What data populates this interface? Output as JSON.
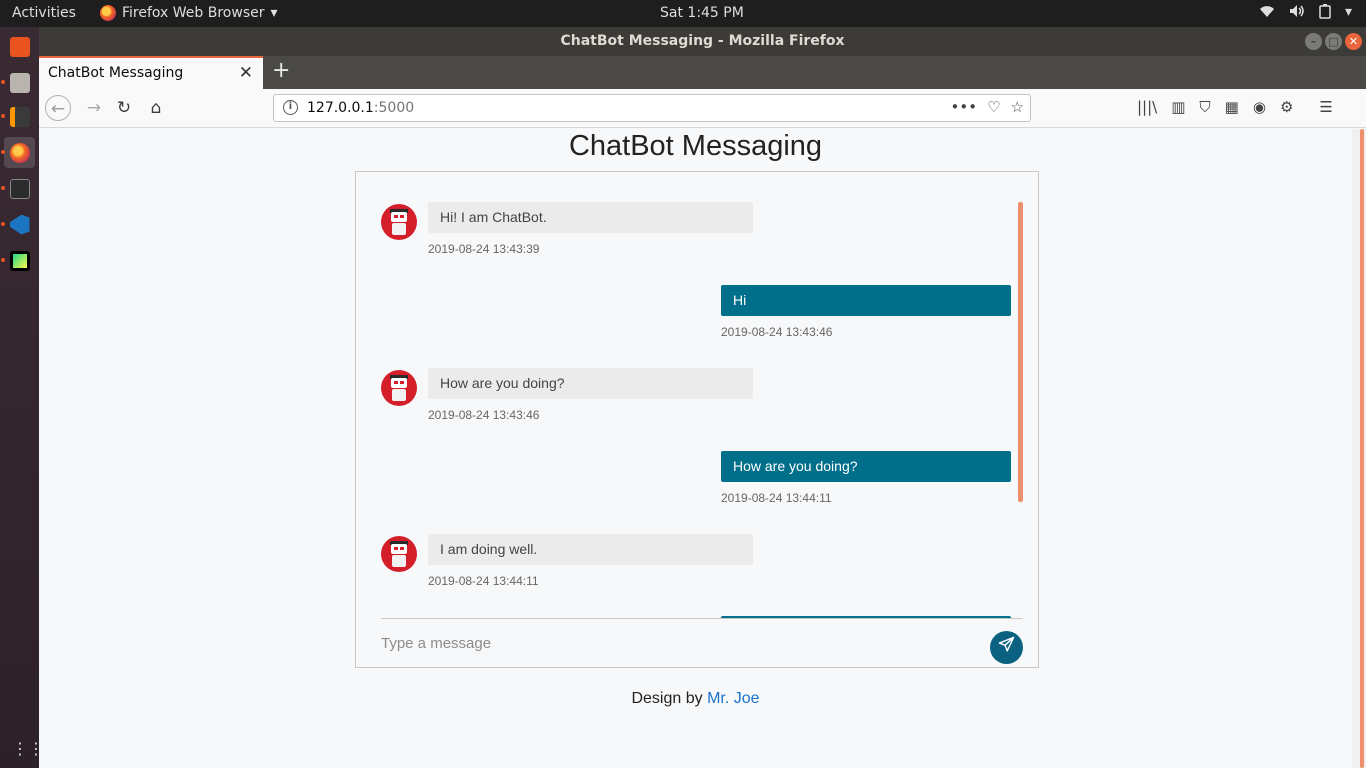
{
  "topbar": {
    "activities": "Activities",
    "app_menu": "Firefox Web Browser",
    "clock": "Sat  1:45 PM",
    "tray_icons": [
      "wifi-icon",
      "volume-icon",
      "battery-icon",
      "power-menu-icon"
    ]
  },
  "dock": {
    "items": [
      "ubuntu-software-icon",
      "files-icon",
      "sublime-text-icon",
      "firefox-icon",
      "terminal-icon",
      "vscode-icon",
      "pycharm-icon"
    ],
    "show_apps": "⋮⋮⋮"
  },
  "window": {
    "title": "ChatBot Messaging - Mozilla Firefox",
    "tab_title": "ChatBot Messaging",
    "url_host": "127.0.0.1",
    "url_port": ":5000"
  },
  "page": {
    "title": "ChatBot Messaging",
    "messages": [
      {
        "from": "bot",
        "text": "Hi! I am ChatBot.",
        "time": "2019-08-24 13:43:39"
      },
      {
        "from": "user",
        "text": "Hi",
        "time": "2019-08-24 13:43:46"
      },
      {
        "from": "bot",
        "text": "How are you doing?",
        "time": "2019-08-24 13:43:46"
      },
      {
        "from": "user",
        "text": "How are you doing?",
        "time": "2019-08-24 13:44:11"
      },
      {
        "from": "bot",
        "text": "I am doing well.",
        "time": "2019-08-24 13:44:11"
      }
    ],
    "input_placeholder": "Type a message",
    "footer_prefix": "Design by ",
    "footer_author": "Mr. Joe"
  },
  "colors": {
    "user_bubble": "#00708a",
    "bot_bubble": "#ebebeb",
    "send_button": "#0b6280",
    "scrollbar": "#ee8f6d",
    "tab_accent": "#e9653b"
  }
}
